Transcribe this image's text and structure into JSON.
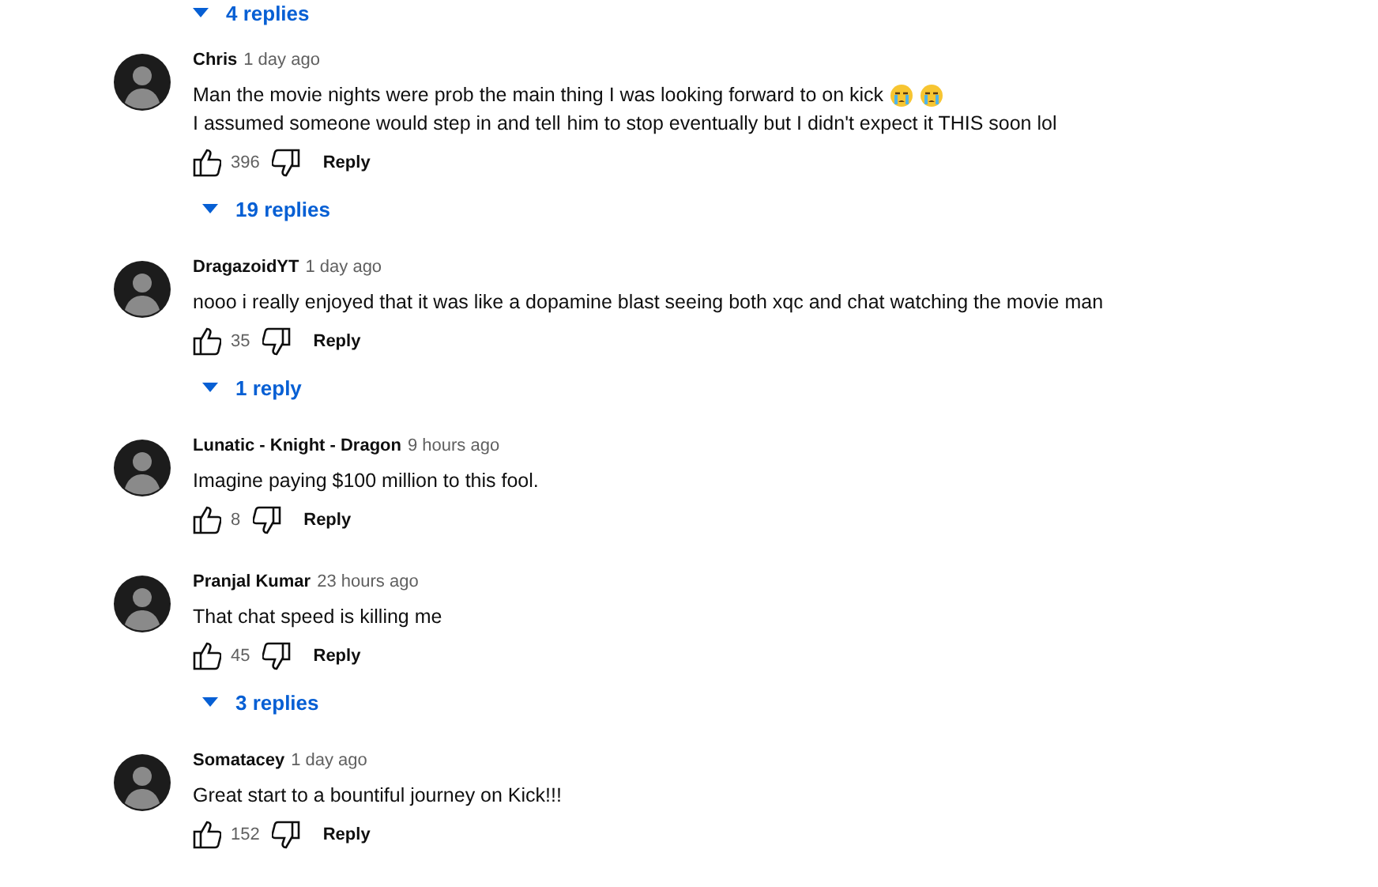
{
  "top_replies": {
    "label": "4 replies"
  },
  "comments": [
    {
      "author": "Chris",
      "time": "1 day ago",
      "body": [
        {
          "kind": "text",
          "text": "Man the movie nights were prob the main thing I was looking forward to on kick"
        },
        {
          "kind": "emoji"
        },
        {
          "kind": "emoji"
        },
        {
          "kind": "text",
          "text": "I assumed someone would step in and tell"
        },
        {
          "kind": "text",
          "text": "him to stop eventually but I didn't expect it THIS soon lol"
        }
      ],
      "likes": "396",
      "reply": "Reply",
      "replies": "19 replies"
    },
    {
      "author": "DragazoidYT",
      "time": "1 day ago",
      "body": [
        {
          "kind": "text",
          "text": "nooo i really enjoyed that it was like a dopamine blast seeing both xqc and chat watching the movie man"
        }
      ],
      "likes": "35",
      "reply": "Reply",
      "replies": "1 reply"
    },
    {
      "author": "Lunatic - Knight - Dragon",
      "time": "9 hours ago",
      "body": [
        {
          "kind": "text",
          "text": "Imagine paying $100 million to this fool."
        }
      ],
      "likes": "8",
      "reply": "Reply"
    },
    {
      "author": "Pranjal Kumar",
      "time": "23 hours ago",
      "body": [
        {
          "kind": "text",
          "text": "That chat speed is killing me"
        }
      ],
      "likes": "45",
      "reply": "Reply",
      "replies": "3 replies"
    },
    {
      "author": "Somatacey",
      "time": "1 day ago",
      "body": [
        {
          "kind": "text",
          "text": "Great start to a bountiful journey on Kick!!!"
        }
      ],
      "likes": "152",
      "reply": "Reply"
    }
  ]
}
